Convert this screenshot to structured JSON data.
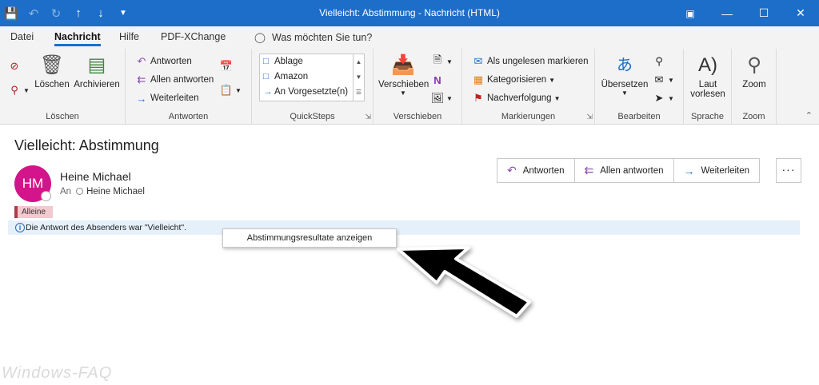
{
  "window": {
    "title": "Vielleicht: Abstimmung  -  Nachricht (HTML)",
    "qat_icons": [
      "save-icon",
      "undo-icon",
      "redo-icon",
      "up-icon",
      "down-icon",
      "customize-icon"
    ],
    "controls": [
      "ribbon-display-icon",
      "minimize-icon",
      "maximize-icon",
      "close-icon"
    ]
  },
  "tabs": [
    {
      "label": "Datei"
    },
    {
      "label": "Nachricht"
    },
    {
      "label": "Hilfe"
    },
    {
      "label": "PDF-XChange"
    }
  ],
  "tellme": "Was möchten Sie tun?",
  "ribbon": {
    "loeschen": {
      "label": "Löschen",
      "delete": "Löschen",
      "archive": "Archivieren"
    },
    "antworten": {
      "label": "Antworten",
      "reply": "Antworten",
      "reply_all": "Allen antworten",
      "forward": "Weiterleiten"
    },
    "quicksteps": {
      "label": "QuickSteps",
      "items": [
        "Ablage",
        "Amazon",
        "An Vorgesetzte(n)"
      ]
    },
    "verschieben": {
      "label": "Verschieben",
      "move": "Verschieben"
    },
    "markierungen": {
      "label": "Markierungen",
      "unread": "Als ungelesen markieren",
      "categorize": "Kategorisieren",
      "followup": "Nachverfolgung"
    },
    "bearbeiten": {
      "label": "Bearbeiten",
      "translate": "Übersetzen"
    },
    "sprache": {
      "label": "Sprache",
      "read_aloud_1": "Laut",
      "read_aloud_2": "vorlesen"
    },
    "zoom": {
      "label": "Zoom",
      "zoom": "Zoom"
    }
  },
  "message": {
    "subject": "Vielleicht: Abstimmung",
    "avatar_initials": "HM",
    "avatar_color": "#d4148a",
    "sender": "Heine Michael",
    "to_label": "An",
    "recipient": "Heine Michael",
    "category": "Alleine",
    "info": "Die Antwort des Absenders war \"Vielleicht\".",
    "popup": "Abstimmungsresultate anzeigen",
    "actions": {
      "reply": "Antworten",
      "reply_all": "Allen antworten",
      "forward": "Weiterleiten",
      "more": "···"
    }
  },
  "watermark": "Windows-FAQ",
  "colors": {
    "titlebar": "#1d6ec8",
    "accent": "#1d6ec8",
    "reply_icon": "#8a4fb0"
  }
}
